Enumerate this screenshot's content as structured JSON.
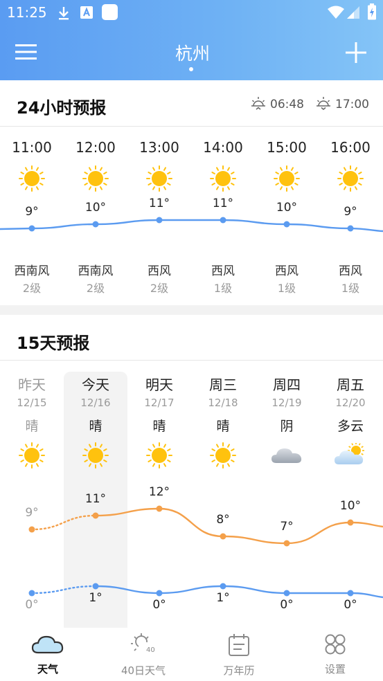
{
  "status": {
    "time": "11:25"
  },
  "header": {
    "city": "杭州"
  },
  "forecast24": {
    "title": "24小时预报",
    "sunrise": "06:48",
    "sunset": "17:00",
    "hours": [
      {
        "time": "11:00",
        "icon": "sun-icon",
        "temp": "9°",
        "wind": "西南风",
        "level": "2级"
      },
      {
        "time": "12:00",
        "icon": "sun-icon",
        "temp": "10°",
        "wind": "西南风",
        "level": "2级"
      },
      {
        "time": "13:00",
        "icon": "sun-icon",
        "temp": "11°",
        "wind": "西风",
        "level": "2级"
      },
      {
        "time": "14:00",
        "icon": "sun-icon",
        "temp": "11°",
        "wind": "西风",
        "level": "1级"
      },
      {
        "time": "15:00",
        "icon": "sun-icon",
        "temp": "10°",
        "wind": "西风",
        "level": "1级"
      },
      {
        "time": "16:00",
        "icon": "sun-icon",
        "temp": "9°",
        "wind": "西风",
        "level": "1级"
      }
    ]
  },
  "forecast15": {
    "title": "15天预报",
    "days": [
      {
        "label": "昨天",
        "date": "12/15",
        "cond": "晴",
        "icon": "sun-icon",
        "high": "9°",
        "low": "0°"
      },
      {
        "label": "今天",
        "date": "12/16",
        "cond": "晴",
        "icon": "sun-icon",
        "high": "11°",
        "low": "1°"
      },
      {
        "label": "明天",
        "date": "12/17",
        "cond": "晴",
        "icon": "sun-icon",
        "high": "12°",
        "low": "0°"
      },
      {
        "label": "周三",
        "date": "12/18",
        "cond": "晴",
        "icon": "sun-icon",
        "high": "8°",
        "low": "1°"
      },
      {
        "label": "周四",
        "date": "12/19",
        "cond": "阴",
        "icon": "cloud-icon",
        "high": "7°",
        "low": "0°"
      },
      {
        "label": "周五",
        "date": "12/20",
        "cond": "多云",
        "icon": "partly-cloudy-icon",
        "high": "10°",
        "low": "0°"
      }
    ]
  },
  "nav": {
    "weather": "天气",
    "forty": "40日天气",
    "forty_badge": "40",
    "calendar": "万年历",
    "settings": "设置"
  },
  "colors": {
    "accent": "#5b9bf0",
    "high_line": "#f4a04a",
    "low_line": "#5b9bf0",
    "sun": "#ffc20e"
  }
}
